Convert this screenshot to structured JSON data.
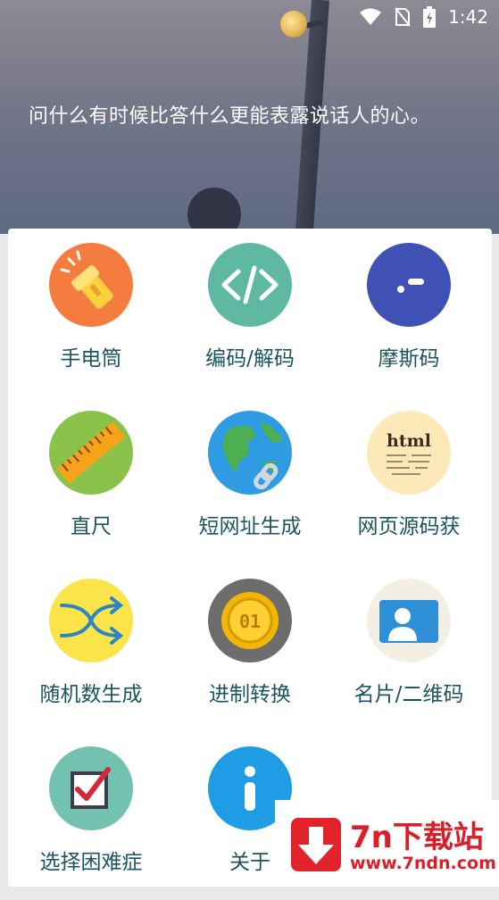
{
  "status_bar": {
    "time": "1:42"
  },
  "header": {
    "quote": "问什么有时候比答什么更能表露说话人的心。"
  },
  "tools": [
    {
      "label": "手电筒",
      "icon": "flashlight-icon",
      "color": "#f57c3f"
    },
    {
      "label": "编码/解码",
      "icon": "code-icon",
      "color": "#5fb8a2"
    },
    {
      "label": "摩斯码",
      "icon": "morse-icon",
      "color": "#3f51b5"
    },
    {
      "label": "直尺",
      "icon": "ruler-icon",
      "color": "#8bc34a"
    },
    {
      "label": "短网址生成",
      "icon": "globe-link-icon",
      "color": "#2f9be3"
    },
    {
      "label": "网页源码获",
      "icon": "html-paper-icon",
      "color": "#fde9b8"
    },
    {
      "label": "随机数生成",
      "icon": "shuffle-icon",
      "color": "#fbe34a"
    },
    {
      "label": "进制转换",
      "icon": "binary-coin-icon",
      "color": "#6d6d6d"
    },
    {
      "label": "名片/二维码",
      "icon": "contact-card-icon",
      "color": "#f3efe2"
    },
    {
      "label": "选择困难症",
      "icon": "checkbox-icon",
      "color": "#73c2b0"
    },
    {
      "label": "关于",
      "icon": "info-icon",
      "color": "#1f9de4"
    }
  ],
  "watermark": {
    "title": "7n下载站",
    "url": "www.7ndn.com"
  }
}
